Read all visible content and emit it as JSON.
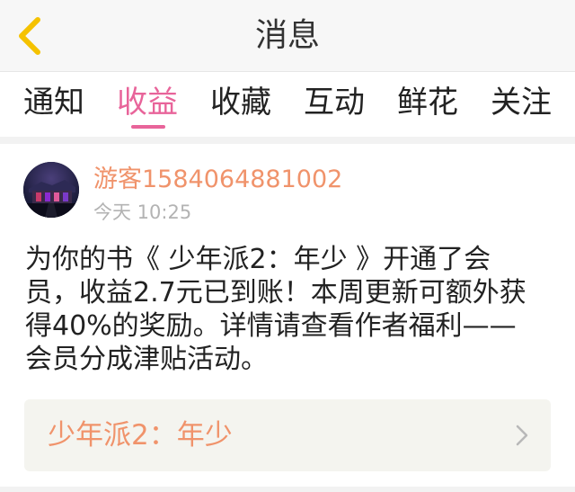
{
  "header": {
    "title": "消息",
    "back_icon": "back-arrow-icon",
    "accent_color": "#f5c200"
  },
  "tabs": {
    "active": "收益",
    "active_color": "#e8649a",
    "items": [
      {
        "label": "通知"
      },
      {
        "label": "收益"
      },
      {
        "label": "收藏"
      },
      {
        "label": "互动"
      },
      {
        "label": "鲜花"
      },
      {
        "label": "关注"
      }
    ]
  },
  "message": {
    "sender": "游客1584064881002",
    "time": "今天 10:25",
    "body": "为你的书《 少年派2：年少 》开通了会员，收益2.7元已到账！本周更新可额外获得40%的奖励。详情请查看作者福利——会员分成津贴活动。",
    "name_color": "#f0936b"
  },
  "book_card": {
    "title": "少年派2：年少",
    "chevron_icon": "chevron-right-icon"
  }
}
